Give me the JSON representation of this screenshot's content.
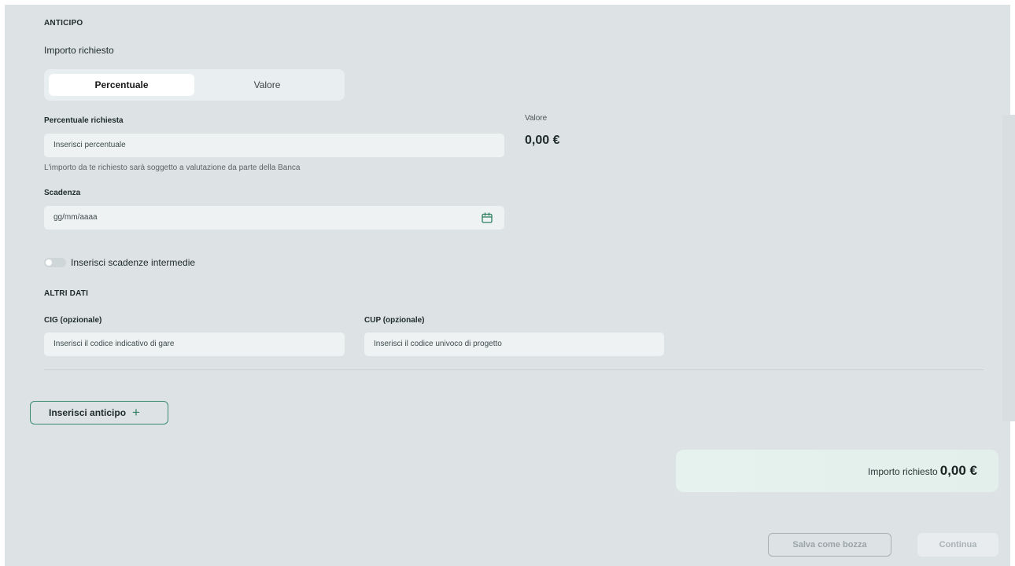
{
  "anticipo": {
    "section_title": "ANTICIPO",
    "importo_label": "Importo richiesto",
    "segmented": {
      "options": [
        "Percentuale",
        "Valore"
      ],
      "selected": "Percentuale"
    },
    "percentuale": {
      "label": "Percentuale richiesta",
      "placeholder": "Inserisci percentuale",
      "helper": "L'importo da te richiesto sarà soggetto a valutazione da parte della Banca"
    },
    "valore": {
      "label": "Valore",
      "amount": "0,00 €"
    },
    "scadenza": {
      "label": "Scadenza",
      "placeholder": "gg/mm/aaaa",
      "icon": "calendar-icon"
    },
    "toggle": {
      "label": "Inserisci scadenze intermedie",
      "checked": false
    }
  },
  "altri_dati": {
    "section_title": "ALTRI DATI",
    "cig": {
      "label": "CIG (opzionale)",
      "placeholder": "Inserisci il codice indicativo di gare"
    },
    "cup": {
      "label": "CUP (opzionale)",
      "placeholder": "Inserisci il codice univoco di progetto"
    }
  },
  "actions": {
    "add_anticipo": "Inserisci anticipo",
    "add_icon": "plus-icon",
    "save_draft": "Salva come bozza",
    "continue": "Continua"
  },
  "summary": {
    "label": "Importo richiesto",
    "amount": "0,00 €"
  },
  "colors": {
    "background": "#dde3e5",
    "accent": "#3a8a6e",
    "summary_card": "#e6f2ee"
  }
}
